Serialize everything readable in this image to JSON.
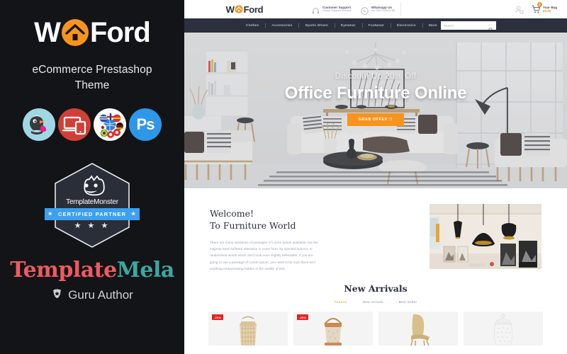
{
  "promo": {
    "brand_w": "W",
    "brand_rest": "Ford",
    "logo_icon": "house-icon",
    "subtitle_line1": "eCommerce Prestashop",
    "subtitle_line2": "Theme",
    "feature_icons": [
      {
        "name": "prestashop-icon",
        "label": "PrestaShop"
      },
      {
        "name": "responsive-devices-icon",
        "label": "Responsive"
      },
      {
        "name": "multilanguage-flags-icon",
        "label": "Multi Language"
      },
      {
        "name": "photoshop-icon",
        "label": "Ps"
      }
    ],
    "badge": {
      "monster_icon": "template-monster-mascot-icon",
      "name": "TemplateMonster",
      "ribbon": "CERTIFIED PARTNER",
      "ribbon_star": "★",
      "stars": "★ ★ ★"
    },
    "author": {
      "name_part1": "Template",
      "name_part2": "Mela",
      "guru_icon": "guru-shield-icon",
      "guru_label": "Guru Author"
    },
    "colors": {
      "background": "#131417",
      "orange": "#f7941e",
      "red": "#ef5a62",
      "teal": "#3ba9a0",
      "blue": "#3da0f0"
    }
  },
  "site": {
    "logo": {
      "w": "W",
      "rest": "Ford",
      "icon": "house-icon"
    },
    "header_info": [
      {
        "icon": "headphones-icon",
        "title": "Customer Support",
        "subtitle": "Online Support Service"
      },
      {
        "icon": "whatsapp-icon",
        "title": "Whatsapp Us",
        "subtitle": "no. 000-2345-6789"
      }
    ],
    "account_icon": "user-account-icon",
    "cart": {
      "icon": "shopping-cart-icon",
      "count": "0",
      "label": "Your Bag",
      "total": "$0.00"
    },
    "nav": [
      {
        "label": "Clothes"
      },
      {
        "label": "Accessories"
      },
      {
        "label": "Sports Shoes"
      },
      {
        "label": "Eyewear"
      },
      {
        "label": "Footwear"
      },
      {
        "label": "Electronics"
      },
      {
        "label": "More"
      }
    ],
    "search": {
      "placeholder": "Search",
      "icon": "search-icon"
    },
    "hero": {
      "eyebrow": "Discount Up 20% Off",
      "headline": "Office Furniture Online",
      "cta": "GRAB OFFER !!",
      "cta_color": "#f7941e",
      "image_alt": "living-room-furniture-photo"
    },
    "welcome": {
      "title_line1": "Welcome!",
      "title_line2": "To Furniture World",
      "body": "There are many variations of passages of Lorem Ipsum available, but the majority have suffered alteration in some form, by injected humour, or randomised words which don't look even slightly believable. If you are going to use a passage of Lorem Ipsum, you need to be sure there isn't anything embarrassing hidden in the middle of text.",
      "image_alt": "pendant-lamps-interior-photo"
    },
    "arrivals": {
      "title": "New Arrivals",
      "tabs": [
        {
          "label": "Feature",
          "active": true
        },
        {
          "label": "New Arrivals",
          "active": false
        },
        {
          "label": "Best Seller",
          "active": false
        }
      ],
      "products": [
        {
          "name": "rattan-lantern",
          "badge": "-20%"
        },
        {
          "name": "copper-jar",
          "badge": "-20%"
        },
        {
          "name": "wooden-chair",
          "badge": ""
        },
        {
          "name": "white-ceramic-jar",
          "badge": ""
        }
      ]
    }
  }
}
